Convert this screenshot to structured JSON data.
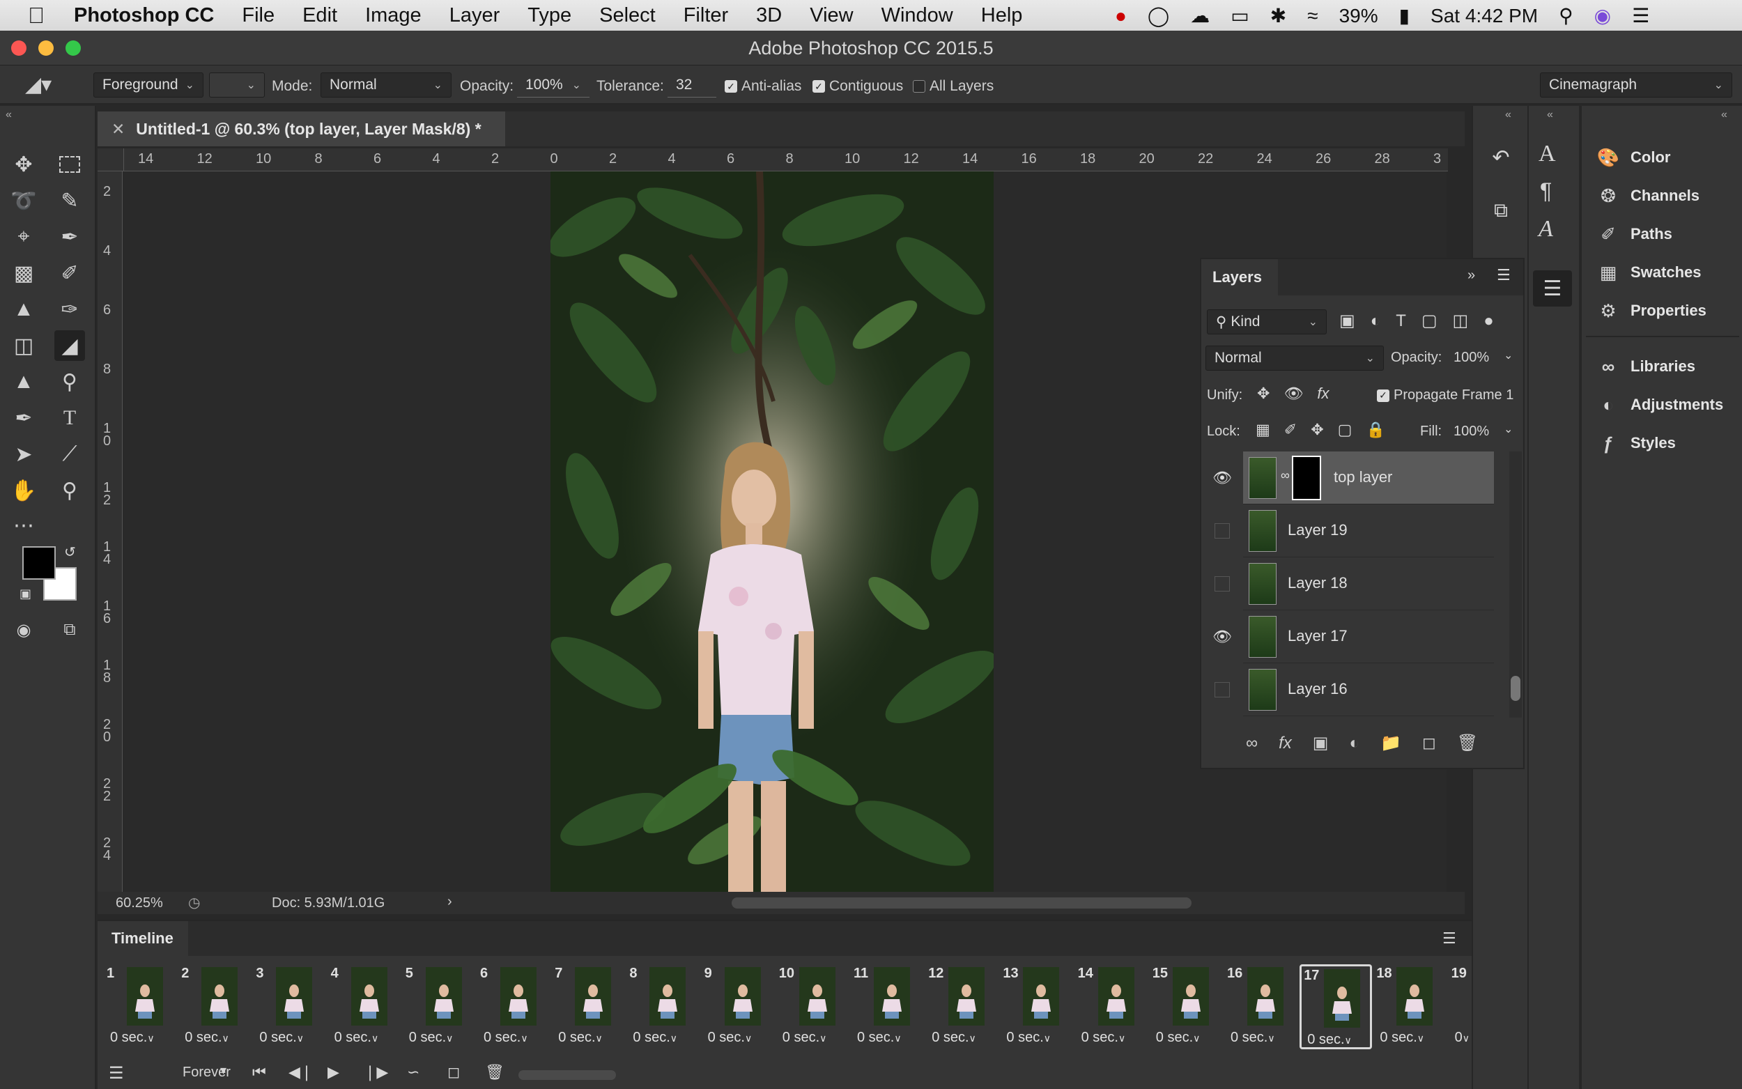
{
  "menubar": {
    "apple_icon": "apple-icon",
    "app_name": "Photoshop CC",
    "menus": [
      "File",
      "Edit",
      "Image",
      "Layer",
      "Type",
      "Select",
      "Filter",
      "3D",
      "View",
      "Window",
      "Help"
    ],
    "battery": "39%",
    "clock": "Sat 4:42 PM"
  },
  "window": {
    "title": "Adobe Photoshop CC 2015.5"
  },
  "options": {
    "fill_source": "Foreground",
    "mode_label": "Mode:",
    "mode_value": "Normal",
    "opacity_label": "Opacity:",
    "opacity_value": "100%",
    "tolerance_label": "Tolerance:",
    "tolerance_value": "32",
    "anti_alias": "Anti-alias",
    "contiguous": "Contiguous",
    "all_layers": "All Layers",
    "workspace": "Cinemagraph"
  },
  "document": {
    "tab_title": "Untitled-1 @ 60.3% (top layer, Layer Mask/8) *",
    "zoom": "60.25%",
    "doc_size": "Doc: 5.93M/1.01G",
    "ruler_h": [
      "14",
      "12",
      "10",
      "8",
      "6",
      "4",
      "2",
      "0",
      "2",
      "4",
      "6",
      "8",
      "10",
      "12",
      "14",
      "16",
      "18",
      "20",
      "22",
      "24",
      "26",
      "28",
      "3"
    ],
    "ruler_v": [
      "2",
      "4",
      "6",
      "8",
      "1\n0",
      "1\n2",
      "1\n4",
      "1\n6",
      "1\n8",
      "2\n0",
      "2\n2",
      "2\n4"
    ]
  },
  "panels": {
    "items": [
      "Color",
      "Channels",
      "Paths",
      "Swatches",
      "Properties",
      "Libraries",
      "Adjustments",
      "Styles"
    ]
  },
  "layers": {
    "title": "Layers",
    "filter_kind": "Kind",
    "blend_mode": "Normal",
    "opacity_label": "Opacity:",
    "opacity_value": "100%",
    "unify_label": "Unify:",
    "propagate": "Propagate Frame 1",
    "lock_label": "Lock:",
    "fill_label": "Fill:",
    "fill_value": "100%",
    "rows": [
      {
        "name": "top layer",
        "visible": true,
        "selected": true
      },
      {
        "name": "Layer 19",
        "visible": false,
        "selected": false
      },
      {
        "name": "Layer 18",
        "visible": false,
        "selected": false
      },
      {
        "name": "Layer 17",
        "visible": true,
        "selected": false
      },
      {
        "name": "Layer 16",
        "visible": false,
        "selected": false
      }
    ]
  },
  "timeline": {
    "title": "Timeline",
    "loop": "Forever",
    "frames": [
      {
        "n": "1",
        "delay": "0 sec."
      },
      {
        "n": "2",
        "delay": "0 sec."
      },
      {
        "n": "3",
        "delay": "0 sec."
      },
      {
        "n": "4",
        "delay": "0 sec."
      },
      {
        "n": "5",
        "delay": "0 sec."
      },
      {
        "n": "6",
        "delay": "0 sec."
      },
      {
        "n": "7",
        "delay": "0 sec."
      },
      {
        "n": "8",
        "delay": "0 sec."
      },
      {
        "n": "9",
        "delay": "0 sec."
      },
      {
        "n": "10",
        "delay": "0 sec."
      },
      {
        "n": "11",
        "delay": "0 sec."
      },
      {
        "n": "12",
        "delay": "0 sec."
      },
      {
        "n": "13",
        "delay": "0 sec."
      },
      {
        "n": "14",
        "delay": "0 sec."
      },
      {
        "n": "15",
        "delay": "0 sec."
      },
      {
        "n": "16",
        "delay": "0 sec."
      },
      {
        "n": "17",
        "delay": "0 sec.",
        "selected": true
      },
      {
        "n": "18",
        "delay": "0 sec."
      },
      {
        "n": "19",
        "delay": "0"
      }
    ]
  }
}
